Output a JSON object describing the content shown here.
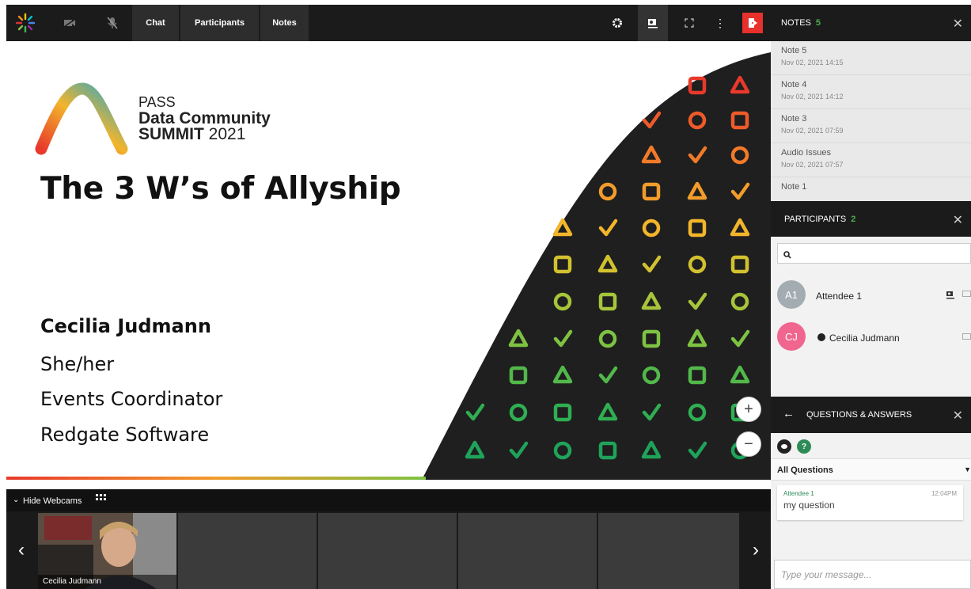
{
  "toolbar": {
    "tabs": [
      {
        "label": "Chat"
      },
      {
        "label": "Participants"
      },
      {
        "label": "Notes"
      }
    ],
    "logo_icon": "starburst-logo-icon",
    "camera_icon": "camera-off-icon",
    "mic_icon": "mic-off-icon",
    "settings_icon": "gear-icon",
    "presenter_icon": "presenter-icon",
    "fullscreen_icon": "fullscreen-icon",
    "more_icon": "kebab-menu-icon",
    "leave_icon": "leave-session-icon",
    "leave_color": "#e8302c"
  },
  "slide": {
    "pass_label": "PASS",
    "event_line1": "Data Community",
    "event_line2a": "SUMMIT",
    "event_line2b": "2021",
    "title": "The 3 W’s of Allyship",
    "speaker": "Cecilia Judmann",
    "pronouns": "She/her",
    "role": "Events Coordinator",
    "company": "Redgate Software"
  },
  "zoom": {
    "in": "+",
    "out": "−"
  },
  "webcams": {
    "toggle_label": "Hide Webcams",
    "grid_icon": "grid-icon",
    "tiles": [
      {
        "name": "Cecilia Judmann"
      }
    ],
    "prev": "‹",
    "next": "›"
  },
  "notes": {
    "header": "NOTES",
    "count": "5",
    "items": [
      {
        "title": "Note 5",
        "date": "Nov 02, 2021 14:15"
      },
      {
        "title": "Note 4",
        "date": "Nov 02, 2021 14:12"
      },
      {
        "title": "Note 3",
        "date": "Nov 02, 2021 07:59"
      },
      {
        "title": "Audio Issues",
        "date": "Nov 02, 2021 07:57"
      },
      {
        "title": "Note 1",
        "date": ""
      }
    ]
  },
  "participants": {
    "header": "PARTICIPANTS",
    "count": "2",
    "list": [
      {
        "initials": "A1",
        "name": "Attendee 1",
        "color": "#a3acb0"
      },
      {
        "initials": "CJ",
        "name": "Cecilia Judmann",
        "color": "#f0668e"
      }
    ]
  },
  "qa": {
    "header": "QUESTIONS & ANSWERS",
    "filter": "All Questions",
    "question": {
      "author": "Attendee 1",
      "time": "12:04PM",
      "text": "my question"
    },
    "input_placeholder": "Type your message..."
  },
  "close_symbol": "✕",
  "back_symbol": "←",
  "accent_green": "#4cae4c"
}
